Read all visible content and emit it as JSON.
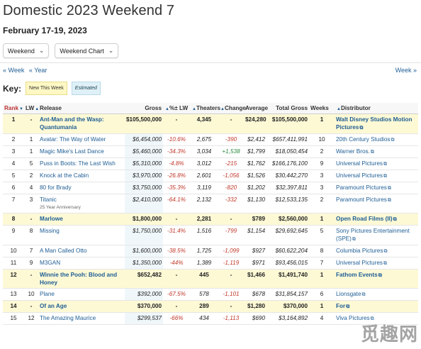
{
  "page": {
    "title": "Domestic 2023 Weekend 7",
    "subtitle": "February 17-19, 2023"
  },
  "controls": {
    "weekend_dropdown": "Weekend",
    "chart_dropdown": "Weekend Chart"
  },
  "nav": {
    "prev_week": "« Week",
    "prev_year": "« Year",
    "next_week": "Week »"
  },
  "key": {
    "label": "Key:",
    "new_this_week": "New This Week",
    "estimated": "Estimated"
  },
  "table": {
    "headers": [
      "Rank",
      "LW",
      "Release",
      "Gross",
      "%± LW",
      "Theaters",
      "Change",
      "Average",
      "Total Gross",
      "Weeks",
      "Distributor"
    ],
    "rows": [
      {
        "rank": "1",
        "lw": "-",
        "release": "Ant-Man and the Wasp: Quantumania",
        "sub": "",
        "gross": "$105,500,000",
        "pct": "-",
        "theaters": "4,345",
        "change": "-",
        "average": "$24,280",
        "total": "$105,500,000",
        "weeks": "1",
        "distributor": "Walt Disney Studios Motion Pictures",
        "new": true
      },
      {
        "rank": "2",
        "lw": "1",
        "release": "Avatar: The Way of Water",
        "sub": "",
        "gross": "$6,454,000",
        "pct": "-10.6%",
        "theaters": "2,675",
        "change": "-390",
        "average": "$2,412",
        "total": "$657,411,991",
        "weeks": "10",
        "distributor": "20th Century Studios",
        "new": false
      },
      {
        "rank": "3",
        "lw": "1",
        "release": "Magic Mike's Last Dance",
        "sub": "",
        "gross": "$5,460,000",
        "pct": "-34.3%",
        "theaters": "3,034",
        "change": "+1,538",
        "average": "$1,799",
        "total": "$18,050,454",
        "weeks": "2",
        "distributor": "Warner Bros.",
        "new": false
      },
      {
        "rank": "4",
        "lw": "5",
        "release": "Puss in Boots: The Last Wish",
        "sub": "",
        "gross": "$5,310,000",
        "pct": "-4.8%",
        "theaters": "3,012",
        "change": "-215",
        "average": "$1,762",
        "total": "$166,176,100",
        "weeks": "9",
        "distributor": "Universal Pictures",
        "new": false
      },
      {
        "rank": "5",
        "lw": "2",
        "release": "Knock at the Cabin",
        "sub": "",
        "gross": "$3,970,000",
        "pct": "-26.8%",
        "theaters": "2,601",
        "change": "-1,056",
        "average": "$1,526",
        "total": "$30,442,270",
        "weeks": "3",
        "distributor": "Universal Pictures",
        "new": false
      },
      {
        "rank": "6",
        "lw": "4",
        "release": "80 for Brady",
        "sub": "",
        "gross": "$3,750,000",
        "pct": "-35.3%",
        "theaters": "3,119",
        "change": "-820",
        "average": "$1,202",
        "total": "$32,397,811",
        "weeks": "3",
        "distributor": "Paramount Pictures",
        "new": false
      },
      {
        "rank": "7",
        "lw": "3",
        "release": "Titanic",
        "sub": "25 Year Anniversary",
        "gross": "$2,410,000",
        "pct": "-64.1%",
        "theaters": "2,132",
        "change": "-332",
        "average": "$1,130",
        "total": "$12,533,135",
        "weeks": "2",
        "distributor": "Paramount Pictures",
        "new": false
      },
      {
        "rank": "8",
        "lw": "-",
        "release": "Marlowe",
        "sub": "",
        "gross": "$1,800,000",
        "pct": "-",
        "theaters": "2,281",
        "change": "-",
        "average": "$789",
        "total": "$2,560,000",
        "weeks": "1",
        "distributor": "Open Road Films (II)",
        "new": true
      },
      {
        "rank": "9",
        "lw": "8",
        "release": "Missing",
        "sub": "",
        "gross": "$1,750,000",
        "pct": "-31.4%",
        "theaters": "1,516",
        "change": "-799",
        "average": "$1,154",
        "total": "$29,692,645",
        "weeks": "5",
        "distributor": "Sony Pictures Entertainment (SPE)",
        "new": false
      },
      {
        "rank": "10",
        "lw": "7",
        "release": "A Man Called Otto",
        "sub": "",
        "gross": "$1,600,000",
        "pct": "-38.5%",
        "theaters": "1,725",
        "change": "-1,099",
        "average": "$927",
        "total": "$60,622,204",
        "weeks": "8",
        "distributor": "Columbia Pictures",
        "new": false
      },
      {
        "rank": "11",
        "lw": "9",
        "release": "M3GAN",
        "sub": "",
        "gross": "$1,350,000",
        "pct": "-44%",
        "theaters": "1,389",
        "change": "-1,119",
        "average": "$971",
        "total": "$93,456,015",
        "weeks": "7",
        "distributor": "Universal Pictures",
        "new": false
      },
      {
        "rank": "12",
        "lw": "-",
        "release": "Winnie the Pooh: Blood and Honey",
        "sub": "",
        "gross": "$652,482",
        "pct": "-",
        "theaters": "445",
        "change": "-",
        "average": "$1,466",
        "total": "$1,491,740",
        "weeks": "1",
        "distributor": "Fathom Events",
        "new": true
      },
      {
        "rank": "13",
        "lw": "10",
        "release": "Plane",
        "sub": "",
        "gross": "$392,000",
        "pct": "-67.5%",
        "theaters": "578",
        "change": "-1,101",
        "average": "$678",
        "total": "$31,854,157",
        "weeks": "6",
        "distributor": "Lionsgate",
        "new": false
      },
      {
        "rank": "14",
        "lw": "-",
        "release": "Of an Age",
        "sub": "",
        "gross": "$370,000",
        "pct": "-",
        "theaters": "289",
        "change": "-",
        "average": "$1,280",
        "total": "$370,000",
        "weeks": "1",
        "distributor": "For",
        "new": true
      },
      {
        "rank": "15",
        "lw": "12",
        "release": "The Amazing Maurice",
        "sub": "",
        "gross": "$299,537",
        "pct": "-66%",
        "theaters": "434",
        "change": "-1,113",
        "average": "$690",
        "total": "$3,164,892",
        "weeks": "4",
        "distributor": "Viva Pictures",
        "new": false
      }
    ]
  },
  "watermark": "觅趣网"
}
